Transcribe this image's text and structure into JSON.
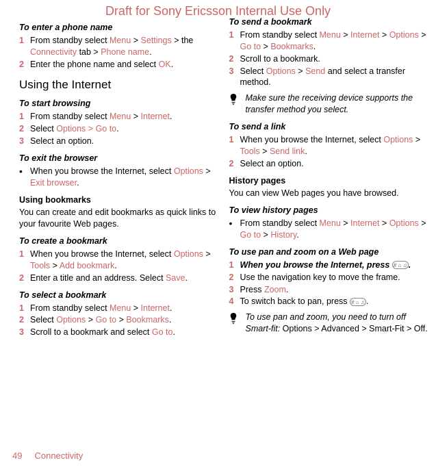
{
  "watermark": "Draft for Sony Ericsson Internal Use Only",
  "footer": {
    "page": "49",
    "section": "Connectivity"
  },
  "col1": {
    "enter_phone_name": {
      "title": "To enter a phone name",
      "steps": [
        {
          "num": "1",
          "prefix": "From standby select ",
          "parts": [
            "Menu",
            " > ",
            "Settings",
            " > ",
            "the ",
            "Connectivity",
            " tab > ",
            "Phone name",
            "."
          ]
        },
        {
          "num": "2",
          "prefix": "Enter the phone name and select ",
          "parts": [
            "OK",
            "."
          ]
        }
      ]
    },
    "using_internet": "Using the Internet",
    "start_browsing": {
      "title": "To start browsing",
      "steps": [
        {
          "num": "1",
          "prefix": "From standby select ",
          "parts": [
            "Menu",
            " > ",
            "Internet",
            "."
          ]
        },
        {
          "num": "2",
          "prefix": "Select ",
          "parts": [
            "Options",
            " > ",
            "Go to",
            "."
          ]
        },
        {
          "num": "3",
          "prefix": "Select an option."
        }
      ]
    },
    "exit_browser": {
      "title": "To exit the browser",
      "bullet": {
        "prefix": "When you browse the Internet, select ",
        "parts": [
          "Options",
          " > ",
          "Exit browser",
          "."
        ]
      }
    },
    "using_bookmarks": {
      "heading": "Using bookmarks",
      "body": "You can create and edit bookmarks as quick links to your favourite Web pages."
    },
    "create_bookmark": {
      "title": "To create a bookmark",
      "steps": [
        {
          "num": "1",
          "prefix": "When you browse the Internet, select ",
          "parts": [
            "Options",
            " > ",
            "Tools",
            " > ",
            "Add bookmark",
            "."
          ]
        },
        {
          "num": "2",
          "prefix": "Enter a title and an address. Select ",
          "parts": [
            "Save",
            "."
          ]
        }
      ]
    },
    "select_bookmark": {
      "title": "To select a bookmark",
      "steps": [
        {
          "num": "1",
          "prefix": "From standby select ",
          "parts": [
            "Menu",
            " > ",
            "Internet",
            "."
          ]
        },
        {
          "num": "2",
          "prefix": "Select ",
          "parts": [
            "Options",
            " > ",
            "Go to",
            " > ",
            "Bookmarks",
            "."
          ]
        },
        {
          "num": "3",
          "prefix": "Scroll to a bookmark and select ",
          "parts": [
            "Go to",
            "."
          ]
        }
      ]
    }
  },
  "col2": {
    "send_bookmark": {
      "title": "To send a bookmark",
      "steps": [
        {
          "num": "1",
          "prefix": "From standby select ",
          "parts": [
            "Menu",
            " > ",
            "Internet",
            " > ",
            "Options",
            " > ",
            "Go to",
            " > ",
            "Bookmarks",
            "."
          ]
        },
        {
          "num": "2",
          "prefix": "Scroll to a bookmark."
        },
        {
          "num": "3",
          "prefix": "Select ",
          "parts": [
            "Options",
            " > ",
            "Send"
          ],
          "suffix": " and select a transfer method."
        }
      ]
    },
    "tip1": "Make sure the receiving device supports the transfer method you select.",
    "send_link": {
      "title": "To send a link",
      "steps": [
        {
          "num": "1",
          "prefix": "When you browse the Internet, select ",
          "parts": [
            "Options",
            " > ",
            "Tools",
            " > ",
            "Send link",
            "."
          ]
        },
        {
          "num": "2",
          "prefix": "Select an option."
        }
      ]
    },
    "history_pages": {
      "heading": "History pages",
      "body": "You can view Web pages you have browsed."
    },
    "view_history": {
      "title": "To view history pages",
      "bullet": {
        "prefix": "From standby select ",
        "parts": [
          "Menu",
          " > ",
          "Internet",
          " > ",
          "Options",
          " > ",
          "Go to",
          " > ",
          "History",
          "."
        ]
      }
    },
    "pan_zoom": {
      "title": "To use pan and zoom on a Web page",
      "step1_label": "When you browse the Internet, press",
      "key1": "# ⌂ ♫",
      "step2": "Use the navigation key to move the frame.",
      "step3_prefix": "Press ",
      "step3_red": "Zoom",
      "step4_prefix": "To switch back to pan, press ",
      "key2": "# ⌂ ♫"
    },
    "tip2_prefix": "To use pan and zoom, you need to turn off Smart-fit: ",
    "tip2_suffix": "Options > Advanced > Smart-Fit > Off."
  }
}
